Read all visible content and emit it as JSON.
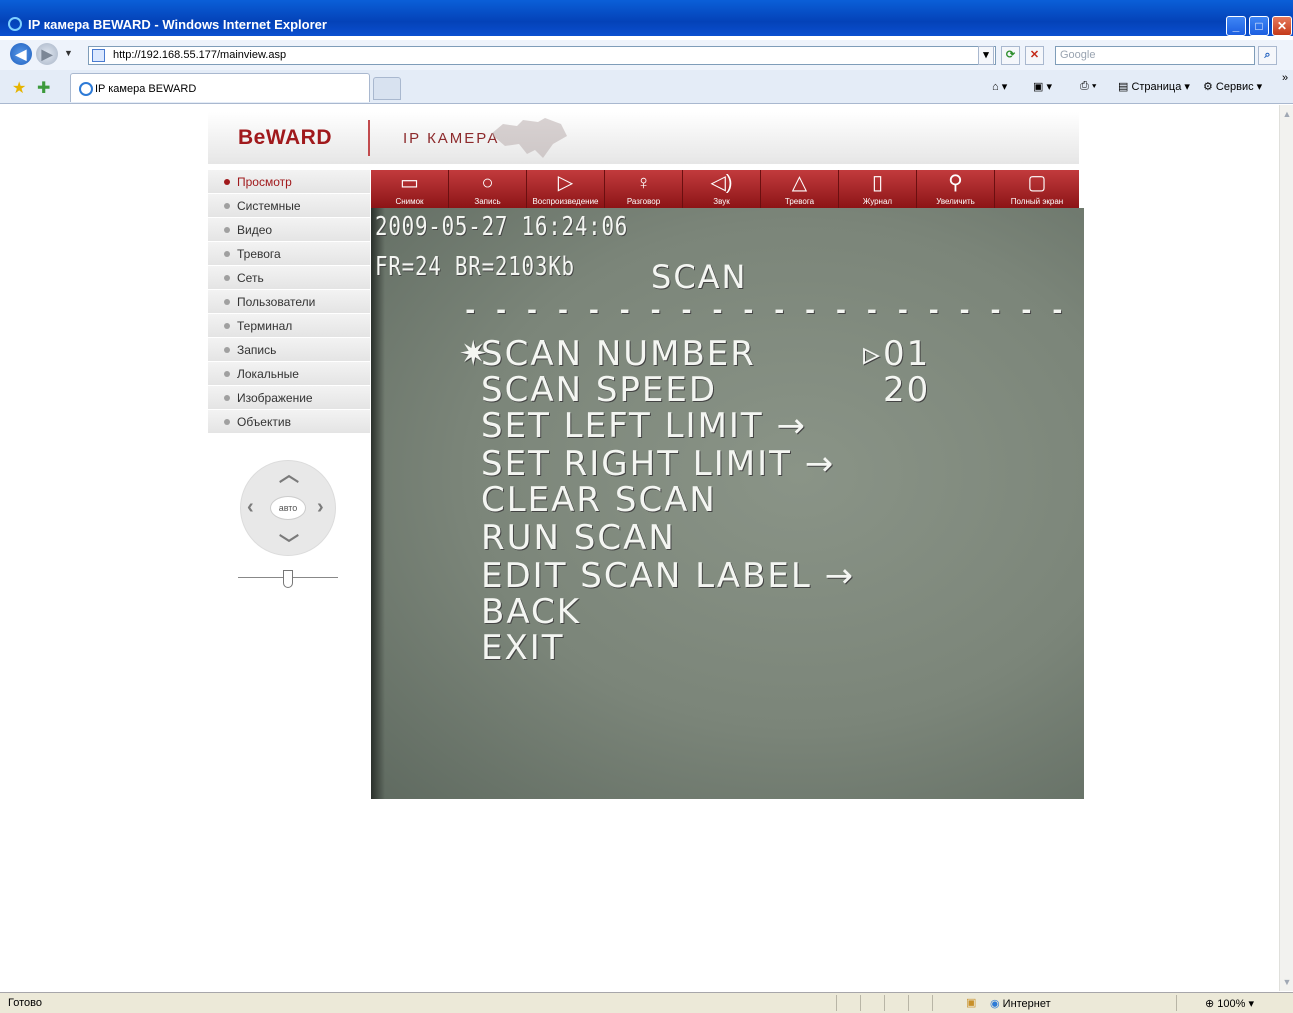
{
  "window": {
    "title": "IP камера BEWARD - Windows Internet Explorer"
  },
  "address": {
    "url": "http://192.168.55.177/mainview.asp",
    "search_placeholder": "Google"
  },
  "tabs": [
    {
      "label": "IP камера BEWARD"
    }
  ],
  "commands": {
    "page": "Страница",
    "tools": "Сервис"
  },
  "header": {
    "logo": "BeWARD",
    "subtitle": "IP КАМЕРА"
  },
  "menu": {
    "items": [
      {
        "label": "Просмотр",
        "active": true
      },
      {
        "label": "Системные",
        "active": false
      },
      {
        "label": "Видео",
        "active": false
      },
      {
        "label": "Тревога",
        "active": false
      },
      {
        "label": "Сеть",
        "active": false
      },
      {
        "label": "Пользователи",
        "active": false
      },
      {
        "label": "Терминал",
        "active": false
      },
      {
        "label": "Запись",
        "active": false
      },
      {
        "label": "Локальные",
        "active": false
      },
      {
        "label": "Изображение",
        "active": false
      },
      {
        "label": "Объектив",
        "active": false
      }
    ]
  },
  "ptz": {
    "auto_label": "авто"
  },
  "toolbar": {
    "buttons": [
      {
        "label": "Снимок",
        "icon": "film-icon"
      },
      {
        "label": "Запись",
        "icon": "record-icon"
      },
      {
        "label": "Воспроизведение",
        "icon": "play-icon"
      },
      {
        "label": "Разговор",
        "icon": "microphone-icon"
      },
      {
        "label": "Звук",
        "icon": "speaker-icon"
      },
      {
        "label": "Тревога",
        "icon": "alarm-icon"
      },
      {
        "label": "Журнал",
        "icon": "log-icon"
      },
      {
        "label": "Увеличить",
        "icon": "magnifier-icon"
      },
      {
        "label": "Полный экран",
        "icon": "fullscreen-icon"
      }
    ]
  },
  "video": {
    "timestamp": "2009-05-27 16:24:06",
    "stats": "FR=24 BR=2103Kb",
    "menu_title": "SCAN",
    "divider": "- - - - - - - - - - - - - - - - - - - - -",
    "lines": [
      {
        "text": "SCAN NUMBER",
        "value": "01"
      },
      {
        "text": "SCAN SPEED",
        "value": "20"
      },
      {
        "text": "SET LEFT LIMIT →",
        "value": ""
      },
      {
        "text": "SET RIGHT LIMIT →",
        "value": ""
      },
      {
        "text": "CLEAR SCAN",
        "value": ""
      },
      {
        "text": "RUN SCAN",
        "value": ""
      },
      {
        "text": "EDIT SCAN LABEL →",
        "value": ""
      },
      {
        "text": "BACK",
        "value": ""
      },
      {
        "text": "EXIT",
        "value": ""
      }
    ]
  },
  "status": {
    "text": "Готово",
    "zone": "Интернет",
    "zoom": "100%"
  },
  "colors": {
    "brand": "#a0191c",
    "toolbar": "#8c1416",
    "xp_blue": "#0442b8"
  }
}
